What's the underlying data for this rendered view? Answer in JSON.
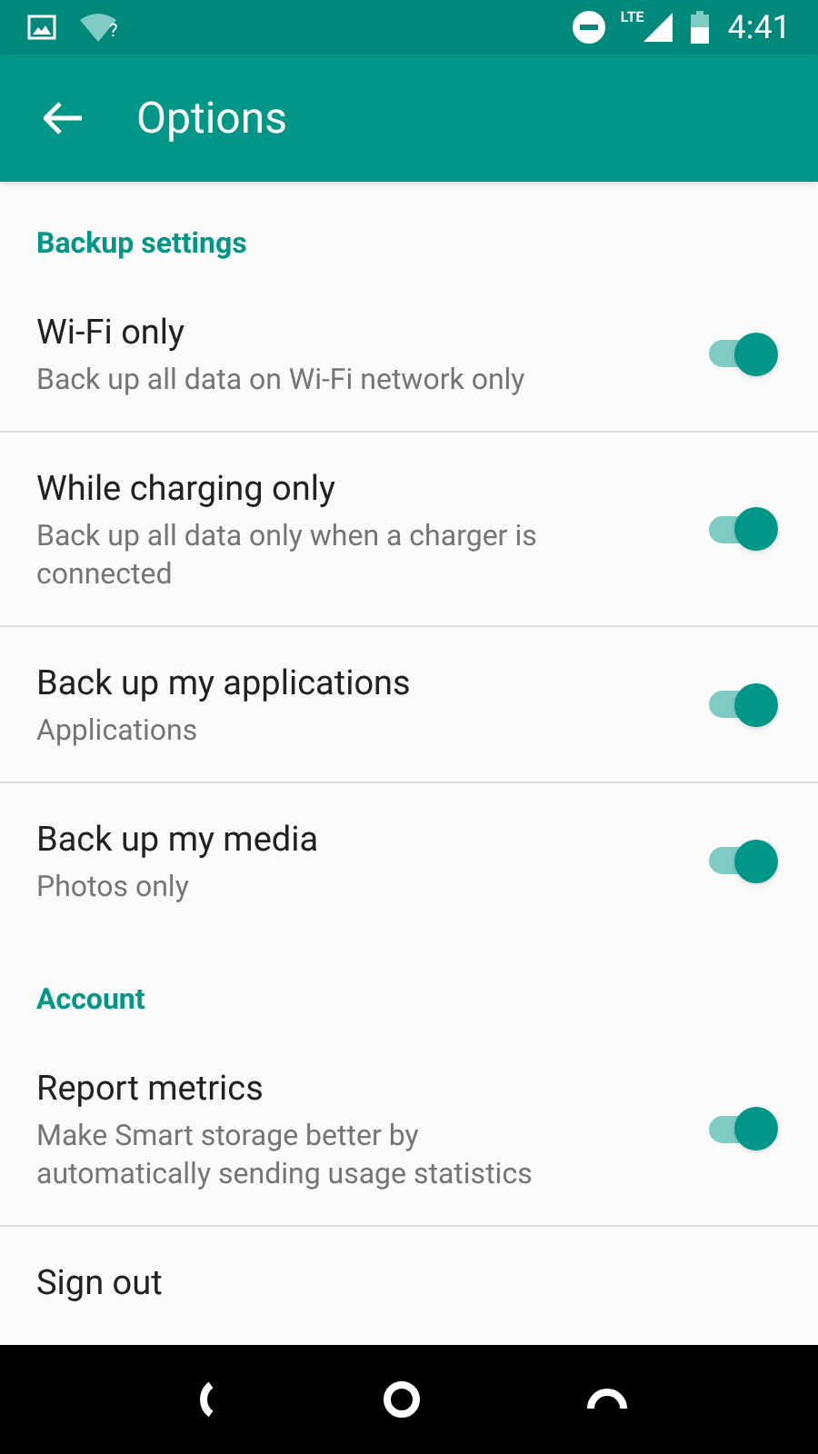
{
  "status_bar": {
    "wifi_badge": "?",
    "network": "LTE",
    "time": "4:41"
  },
  "app_bar": {
    "title": "Options"
  },
  "sections": [
    {
      "header": "Backup settings",
      "items": [
        {
          "kind": "switch",
          "title": "Wi-Fi only",
          "subtitle": "Back up all data on Wi-Fi network only",
          "on": true
        },
        {
          "kind": "switch",
          "title": "While charging only",
          "subtitle": "Back up all data only when a charger is connected",
          "on": true
        },
        {
          "kind": "switch",
          "title": "Back up my applications",
          "subtitle": "Applications",
          "on": true
        },
        {
          "kind": "switch",
          "title": "Back up my media",
          "subtitle": "Photos only",
          "on": true
        }
      ]
    },
    {
      "header": "Account",
      "items": [
        {
          "kind": "switch",
          "title": "Report metrics",
          "subtitle": "Make Smart storage better by automatically sending usage statistics",
          "on": true
        },
        {
          "kind": "action",
          "title": "Sign out"
        }
      ]
    }
  ]
}
